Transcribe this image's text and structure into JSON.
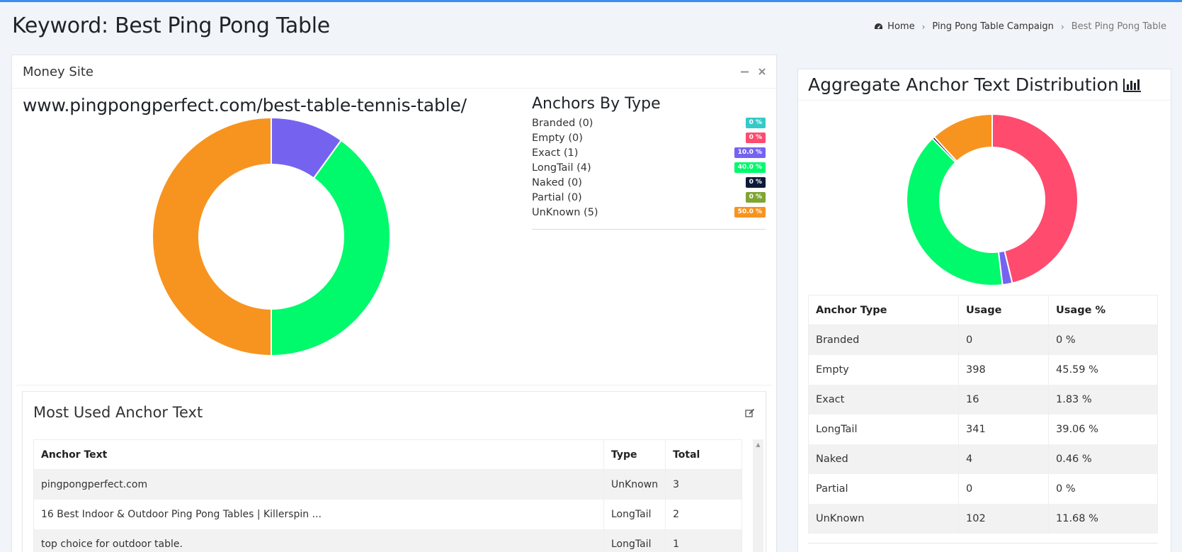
{
  "page": {
    "title": "Keyword: Best Ping Pong Table"
  },
  "breadcrumb": {
    "home": "Home",
    "campaign": "Ping Pong Table Campaign",
    "current": "Best Ping Pong Table"
  },
  "money_site": {
    "title": "Money Site",
    "url": "www.pingpongperfect.com/best-table-tennis-table/",
    "anchors_heading": "Anchors By Type",
    "anchors": [
      {
        "label": "Branded (0)",
        "badge": "0 %",
        "color": "#35c9c9"
      },
      {
        "label": "Empty (0)",
        "badge": "0 %",
        "color": "#ff4b6e"
      },
      {
        "label": "Exact (1)",
        "badge": "10.0 %",
        "color": "#7563f0"
      },
      {
        "label": "LongTail (4)",
        "badge": "40.0 %",
        "color": "#00fa6b"
      },
      {
        "label": "Naked (0)",
        "badge": "0 %",
        "color": "#0d1a3a"
      },
      {
        "label": "Partial (0)",
        "badge": "0 %",
        "color": "#7fa632"
      },
      {
        "label": "UnKnown (5)",
        "badge": "50.0 %",
        "color": "#f7941f"
      }
    ]
  },
  "most_used": {
    "title": "Most Used Anchor Text",
    "columns": [
      "Anchor Text",
      "Type",
      "Total"
    ],
    "rows": [
      {
        "text": "pingpongperfect.com",
        "type": "UnKnown",
        "total": "3"
      },
      {
        "text": "16 Best Indoor & Outdoor Ping Pong Tables | Killerspin ...",
        "type": "LongTail",
        "total": "2"
      },
      {
        "text": "top choice for outdoor table.",
        "type": "LongTail",
        "total": "1"
      }
    ]
  },
  "aggregate": {
    "title": "Aggregate Anchor Text Distribution",
    "columns": [
      "Anchor Type",
      "Usage",
      "Usage %"
    ],
    "rows": [
      {
        "type": "Branded",
        "usage": "0",
        "pct": "0 %"
      },
      {
        "type": "Empty",
        "usage": "398",
        "pct": "45.59 %"
      },
      {
        "type": "Exact",
        "usage": "16",
        "pct": "1.83 %"
      },
      {
        "type": "LongTail",
        "usage": "341",
        "pct": "39.06 %"
      },
      {
        "type": "Naked",
        "usage": "4",
        "pct": "0.46 %"
      },
      {
        "type": "Partial",
        "usage": "0",
        "pct": "0 %"
      },
      {
        "type": "UnKnown",
        "usage": "102",
        "pct": "11.68 %"
      }
    ]
  },
  "chart_data": [
    {
      "type": "pie",
      "categories": [
        "Branded",
        "Empty",
        "Exact",
        "LongTail",
        "Naked",
        "Partial",
        "UnKnown"
      ],
      "values": [
        0,
        0,
        10.0,
        40.0,
        0,
        0,
        50.0
      ],
      "colors": [
        "#35c9c9",
        "#ff4b6e",
        "#7563f0",
        "#00fa6b",
        "#0d1a3a",
        "#7fa632",
        "#f7941f"
      ]
    },
    {
      "type": "pie",
      "categories": [
        "Branded",
        "Empty",
        "Exact",
        "LongTail",
        "Naked",
        "Partial",
        "UnKnown"
      ],
      "values": [
        0,
        398,
        16,
        341,
        4,
        0,
        102
      ],
      "colors": [
        "#35c9c9",
        "#ff4b6e",
        "#7563f0",
        "#00fa6b",
        "#0d1a3a",
        "#7fa632",
        "#f7941f"
      ]
    }
  ]
}
